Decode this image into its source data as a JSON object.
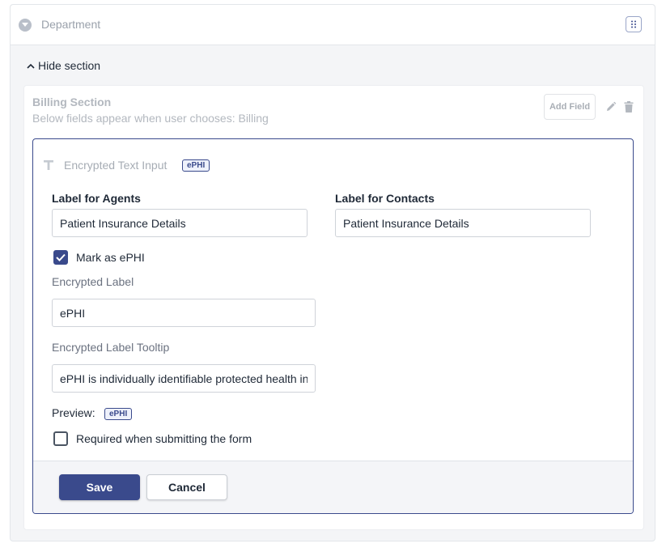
{
  "department": {
    "label": "Department",
    "icon": "chevron-down-circle-icon"
  },
  "section_toggle": {
    "label": "Hide section"
  },
  "billing": {
    "title": "Billing Section",
    "subtitle": "Below fields appear when user chooses: Billing",
    "add_field_label": "Add Field"
  },
  "field": {
    "type_label": "Encrypted Text Input",
    "badge": "ePHI",
    "agents_label": "Label for Agents",
    "agents_value": "Patient Insurance Details",
    "contacts_label": "Label for Contacts",
    "contacts_value": "Patient Insurance Details",
    "mark_ephi_label": "Mark as ePHI",
    "mark_ephi_checked": true,
    "encrypted_label_title": "Encrypted Label",
    "encrypted_label_value": "ePHI",
    "tooltip_title": "Encrypted Label Tooltip",
    "tooltip_value": "ePHI is individually identifiable protected health in",
    "preview_label": "Preview:",
    "preview_badge": "ePHI",
    "required_label": "Required when submitting the form",
    "required_checked": false
  },
  "actions": {
    "save": "Save",
    "cancel": "Cancel"
  },
  "colors": {
    "accent": "#3a4a8c",
    "muted_text": "#9aa1ab",
    "background": "#f4f5f7"
  }
}
